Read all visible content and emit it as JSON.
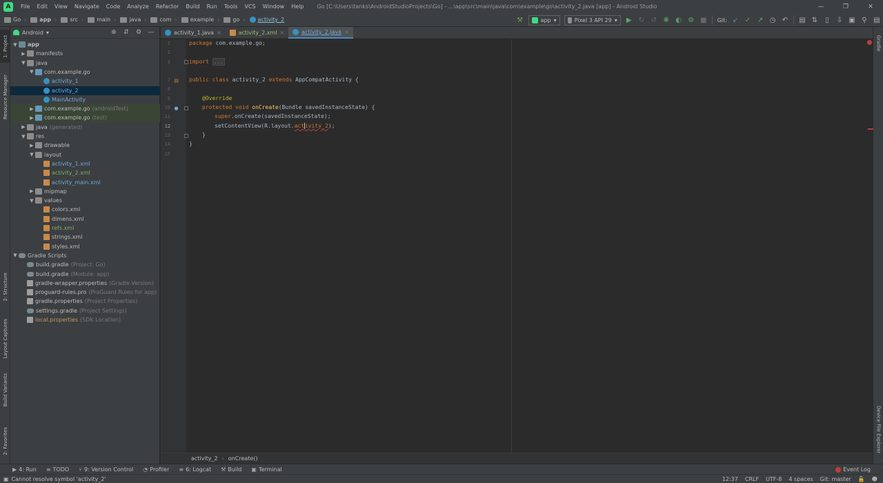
{
  "menubar": {
    "items": [
      "File",
      "Edit",
      "View",
      "Navigate",
      "Code",
      "Analyze",
      "Refactor",
      "Build",
      "Run",
      "Tools",
      "VCS",
      "Window",
      "Help"
    ],
    "window_title": "Go [C:\\Users\\tanks\\AndroidStudioProjects\\Go] - ...\\app\\src\\main\\java\\com\\example\\go\\activity_2.java [app] - Android Studio"
  },
  "breadcrumbs": [
    "Go",
    "app",
    "src",
    "main",
    "java",
    "com",
    "example",
    "go",
    "activity_2"
  ],
  "toolbar": {
    "run_config": "app",
    "device": "Pixel 3 API 29",
    "git_label": "Git:"
  },
  "left_tool_tabs": [
    "1: Project",
    "Resource Manager",
    "2: Structure",
    "Layout Captures",
    "Build Variants",
    "2: Favorites"
  ],
  "right_tool_tabs": [
    "Gradle",
    "Device File Explorer"
  ],
  "project_panel": {
    "view": "Android",
    "tree": [
      {
        "label": "app",
        "depth": 0,
        "icon": "folder-app-icon",
        "expanded": true,
        "bold": true
      },
      {
        "label": "manifests",
        "depth": 1,
        "icon": "folder-icon",
        "collapsed": true
      },
      {
        "label": "java",
        "depth": 1,
        "icon": "folder-icon",
        "expanded": true
      },
      {
        "label": "com.example.go",
        "depth": 2,
        "icon": "package-icon",
        "expanded": true
      },
      {
        "label": "activity_1",
        "depth": 3,
        "icon": "class-icon",
        "color": "blue"
      },
      {
        "label": "activity_2",
        "depth": 3,
        "icon": "class-icon",
        "color": "blue",
        "selected": true
      },
      {
        "label": "MainActivity",
        "depth": 3,
        "icon": "class-icon",
        "color": "blue"
      },
      {
        "label": "com.example.go",
        "depth": 2,
        "icon": "package-icon",
        "collapsed": true,
        "hint": "(androidTest)",
        "tinted": true
      },
      {
        "label": "com.example.go",
        "depth": 2,
        "icon": "package-icon",
        "collapsed": true,
        "hint": "(test)",
        "tinted": true
      },
      {
        "label": "java",
        "depth": 1,
        "icon": "folder-icon",
        "collapsed": true,
        "hint": "(generated)"
      },
      {
        "label": "res",
        "depth": 1,
        "icon": "folder-icon",
        "expanded": true
      },
      {
        "label": "drawable",
        "depth": 2,
        "icon": "folder-icon",
        "collapsed": true
      },
      {
        "label": "layout",
        "depth": 2,
        "icon": "folder-icon",
        "expanded": true
      },
      {
        "label": "activity_1.xml",
        "depth": 3,
        "icon": "xml-icon",
        "color": "blue"
      },
      {
        "label": "activity_2.xml",
        "depth": 3,
        "icon": "xml-icon",
        "color": "green"
      },
      {
        "label": "activity_main.xml",
        "depth": 3,
        "icon": "xml-icon",
        "color": "blue"
      },
      {
        "label": "mipmap",
        "depth": 2,
        "icon": "folder-icon",
        "collapsed": true
      },
      {
        "label": "values",
        "depth": 2,
        "icon": "folder-icon",
        "expanded": true
      },
      {
        "label": "colors.xml",
        "depth": 3,
        "icon": "xml-icon"
      },
      {
        "label": "dimens.xml",
        "depth": 3,
        "icon": "xml-icon"
      },
      {
        "label": "refs.xml",
        "depth": 3,
        "icon": "xml-icon",
        "color": "green"
      },
      {
        "label": "strings.xml",
        "depth": 3,
        "icon": "xml-icon"
      },
      {
        "label": "styles.xml",
        "depth": 3,
        "icon": "xml-icon"
      },
      {
        "label": "Gradle Scripts",
        "depth": 0,
        "icon": "gradle-icon",
        "expanded": true
      },
      {
        "label": "build.gradle",
        "depth": 1,
        "icon": "gradle-icon",
        "hint": "(Project: Go)"
      },
      {
        "label": "build.gradle",
        "depth": 1,
        "icon": "gradle-icon",
        "hint": "(Module: app)"
      },
      {
        "label": "gradle-wrapper.properties",
        "depth": 1,
        "icon": "props-icon",
        "hint": "(Gradle Version)"
      },
      {
        "label": "proguard-rules.pro",
        "depth": 1,
        "icon": "props-icon",
        "hint": "(ProGuard Rules for app)"
      },
      {
        "label": "gradle.properties",
        "depth": 1,
        "icon": "props-icon",
        "hint": "(Project Properties)"
      },
      {
        "label": "settings.gradle",
        "depth": 1,
        "icon": "gradle-icon",
        "hint": "(Project Settings)"
      },
      {
        "label": "local.properties",
        "depth": 1,
        "icon": "props-icon",
        "hint": "(SDK Location)",
        "color": "orange"
      }
    ]
  },
  "editor_tabs": [
    {
      "label": "activity_1.java",
      "type": "java"
    },
    {
      "label": "activity_2.xml",
      "type": "xml"
    },
    {
      "label": "activity_2.java",
      "type": "java",
      "active": true
    }
  ],
  "editor": {
    "line_numbers": [
      "1",
      "2",
      "3",
      "",
      "7",
      "8",
      "9",
      "10",
      "11",
      "12",
      "13",
      "14",
      "15"
    ],
    "code": {
      "l1_kw": "package",
      "l1_rest": " com.example.go;",
      "l3_kw": "import",
      "l3_fold": "...",
      "l7_kw1": "public class",
      "l7_name": " activity_2 ",
      "l7_kw2": "extends",
      "l7_rest": " AppCompatActivity {",
      "l9_ann": "@Override",
      "l10_kw": "protected void",
      "l10_fn": "onCreate",
      "l10_rest": "(Bundle savedInstanceState) {",
      "l11_kw": "super",
      "l11_rest": ".onCreate(savedInstanceState);",
      "l12_pre": "setContentView(R.layout.",
      "l12_err_a": "act",
      "l12_err_b": "ivity_2",
      "l12_post": ");",
      "l13": "}",
      "l14": "}"
    },
    "breadcrumb": [
      "activity_2",
      "onCreate()"
    ]
  },
  "bottom_tabs": [
    {
      "icon": "run-icon",
      "label": "4: Run"
    },
    {
      "icon": "todo-icon",
      "label": "TODO"
    },
    {
      "icon": "vcs-icon",
      "label": "9: Version Control"
    },
    {
      "icon": "profiler-icon",
      "label": "Profiler"
    },
    {
      "icon": "logcat-icon",
      "label": "6: Logcat"
    },
    {
      "icon": "build-icon",
      "label": "Build"
    },
    {
      "icon": "terminal-icon",
      "label": "Terminal"
    }
  ],
  "event_log": "Event Log",
  "status": {
    "message": "Cannot resolve symbol 'activity_2'",
    "position": "12:37",
    "line_sep": "CRLF",
    "encoding": "UTF-8",
    "indent": "4 spaces",
    "git": "Git: master"
  },
  "colors": {
    "background": "#2b2b2b",
    "panel": "#3c3f41",
    "keyword": "#cc7832",
    "annotation": "#bbb529",
    "method": "#ffc66d",
    "selection": "#0d293e",
    "error": "#bc3f3c"
  }
}
